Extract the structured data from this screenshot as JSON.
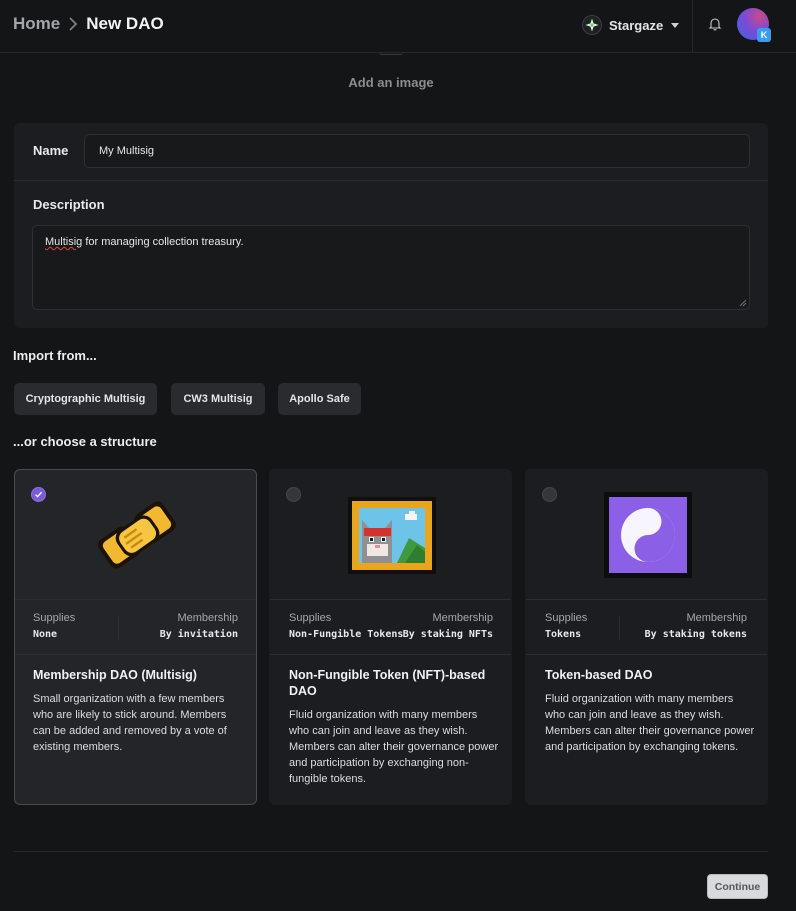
{
  "header": {
    "breadcrumb_home": "Home",
    "breadcrumb_current": "New DAO",
    "chain_name": "Stargaze",
    "avatar_badge": "K"
  },
  "image_picker": {
    "label": "Add an image"
  },
  "form": {
    "name_label": "Name",
    "name_value": "My Multisig",
    "description_label": "Description",
    "description_first_word": "Multisig",
    "description_rest": " for managing collection treasury."
  },
  "import": {
    "title": "Import from...",
    "options": [
      "Cryptographic Multisig",
      "CW3 Multisig",
      "Apollo Safe"
    ]
  },
  "structure": {
    "title": "...or choose a structure",
    "cards": [
      {
        "selected": true,
        "icon": "handshake-icon",
        "supplies_label": "Supplies",
        "supplies_value": "None",
        "membership_label": "Membership",
        "membership_value": "By invitation",
        "title": "Membership DAO (Multisig)",
        "description": "Small organization with a few members who are likely to stick around. Members can be added and removed by a vote of existing members."
      },
      {
        "selected": false,
        "icon": "framed-cat-picture-icon",
        "supplies_label": "Supplies",
        "supplies_value": "Non-Fungible Tokens",
        "membership_label": "Membership",
        "membership_value": "By staking NFTs",
        "title": "Non-Fungible Token (NFT)-based DAO",
        "description": "Fluid organization with many members who can join and leave as they wish. Members can alter their governance power and participation by exchanging non-fungible tokens."
      },
      {
        "selected": false,
        "icon": "yin-yang-icon",
        "supplies_label": "Supplies",
        "supplies_value": "Tokens",
        "membership_label": "Membership",
        "membership_value": "By staking tokens",
        "title": "Token-based DAO",
        "description": "Fluid organization with many members who can join and leave as they wish. Members can alter their governance power and participation by exchanging tokens."
      }
    ]
  },
  "footer": {
    "continue_label": "Continue"
  },
  "colors": {
    "accent": "#7a5ad6",
    "background": "#141517",
    "card": "#1c1d20"
  }
}
